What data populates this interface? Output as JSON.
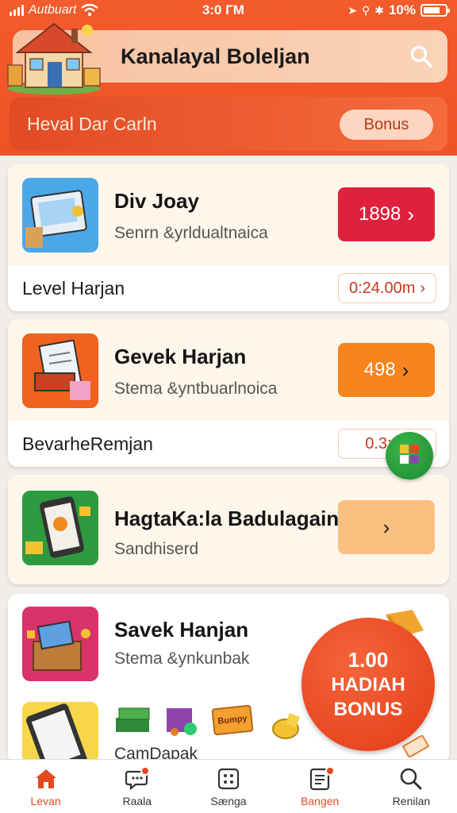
{
  "status_bar": {
    "carrier": "Autbuart",
    "time": "3:0 ГМ",
    "battery": "10%"
  },
  "header": {
    "title": "Kanalayal Boleljan",
    "banner_text": "Heval Dar Carln",
    "bonus_button": "Bonus"
  },
  "cards": [
    {
      "title": "Div Joay",
      "subtitle": "Senrn &yrldualtnaica",
      "price": "1898",
      "footer": "Level Harjan",
      "timer": "0:24.00m"
    },
    {
      "title": "Gevek Harjan",
      "subtitle": "Stema &yntbuarlnoica",
      "price": "498",
      "footer": "BevarheRemjan",
      "timer": "0.3:00"
    },
    {
      "title": "HagtaKa:la Badulagain",
      "subtitle": "Sandhiserd",
      "price": "",
      "footer": "",
      "timer": ""
    },
    {
      "title": "Savek Hanjan",
      "subtitle": "Stema &ynkunbak",
      "footer": "CamDapak"
    }
  ],
  "bonus_badge": {
    "amount": "1.00",
    "line1": "HADIAH",
    "line2": "BONUS"
  },
  "sticker_text": "Bumpy",
  "nav": [
    {
      "label": "Levan",
      "icon": "home-icon",
      "active": true
    },
    {
      "label": "Raala",
      "icon": "chat-icon",
      "active": false
    },
    {
      "label": "Sænga",
      "icon": "grid-icon",
      "active": false
    },
    {
      "label": "Bangen",
      "icon": "list-icon",
      "active": true
    },
    {
      "label": "Renilan",
      "icon": "search-icon",
      "active": false
    }
  ],
  "colors": {
    "brand": "#f35a2c",
    "accent_red": "#e0213d",
    "accent_orange": "#f7841e",
    "accent_light": "#fbbf80"
  }
}
